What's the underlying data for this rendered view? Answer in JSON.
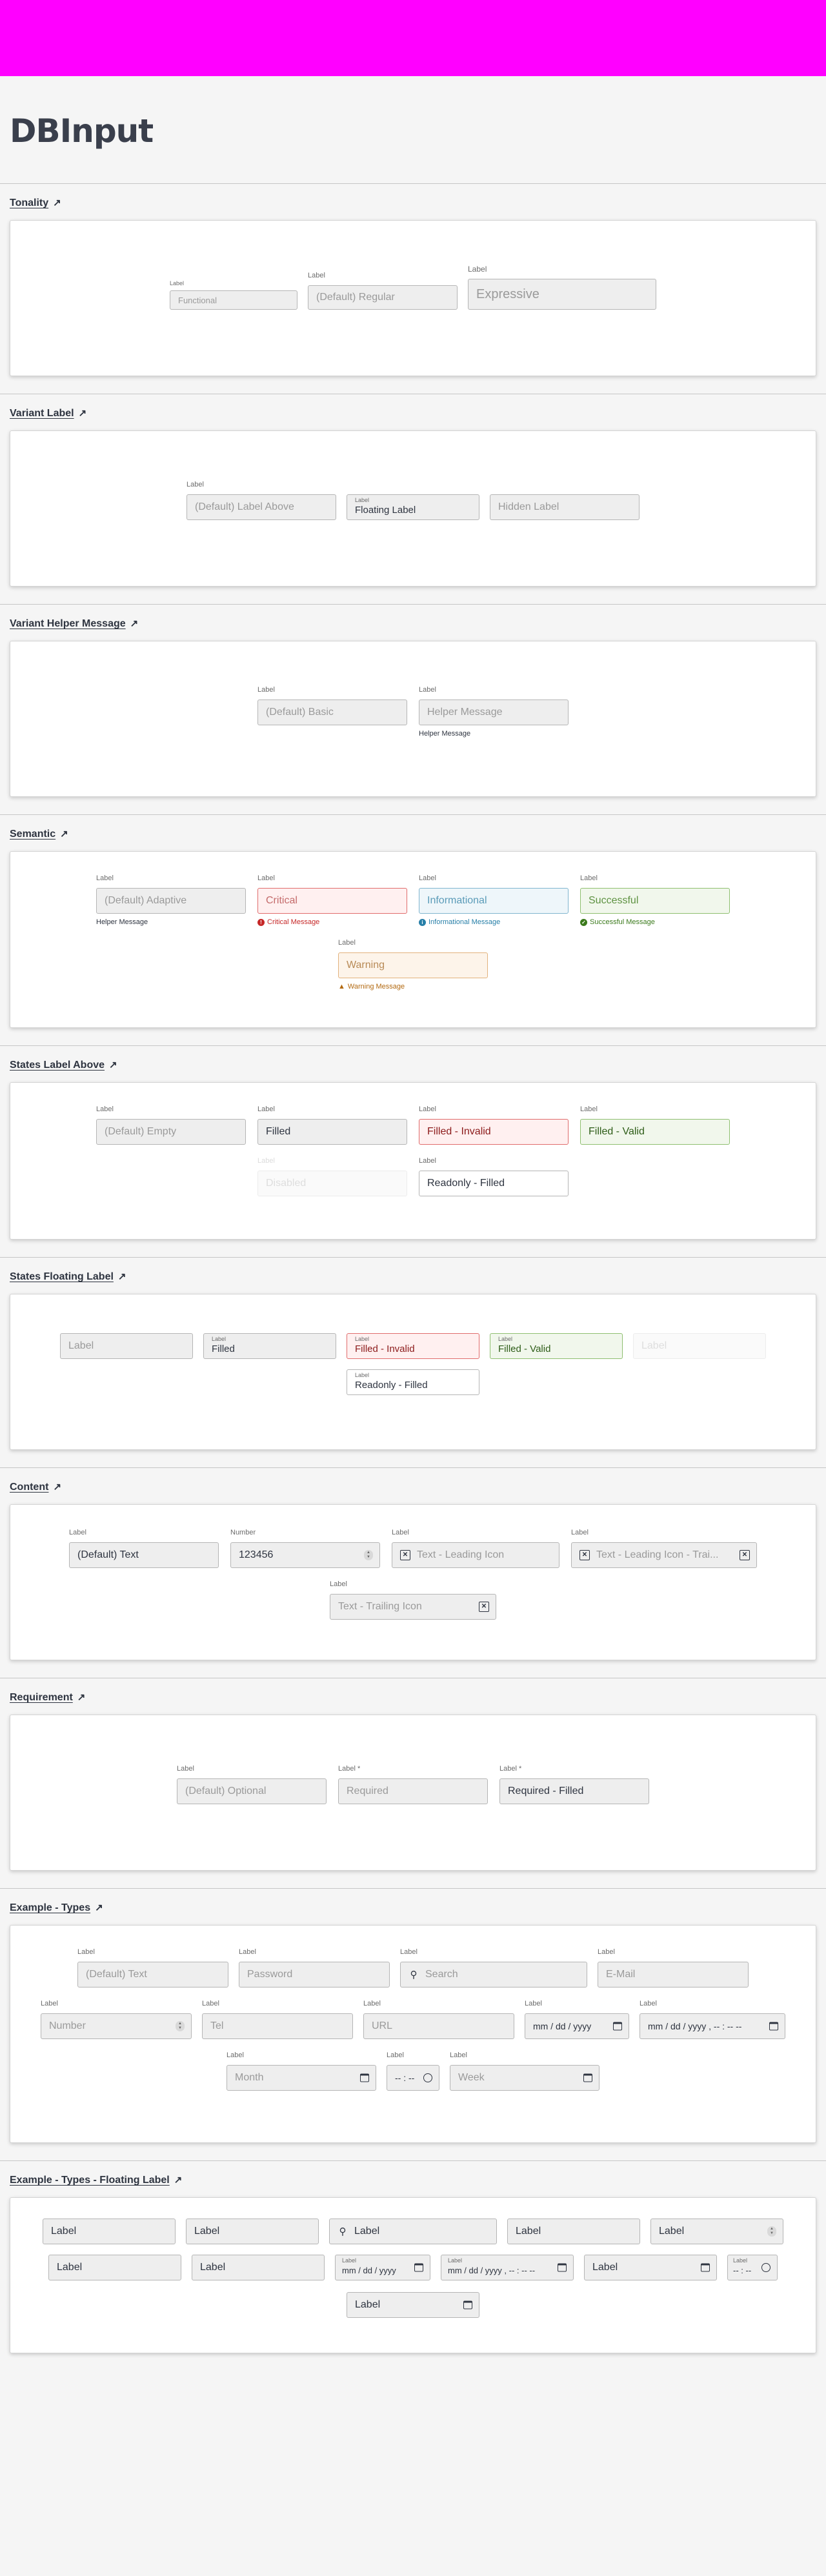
{
  "page": {
    "title": "DBInput",
    "accent": "#ff00ff"
  },
  "icons": {
    "section_link": "arrow-up-right-icon",
    "clear": "clear-x-icon",
    "search": "search-icon",
    "calendar": "calendar-icon",
    "clock": "clock-icon",
    "stepper": "number-stepper-icon"
  },
  "sections": {
    "tonality": {
      "title": "Tonality",
      "fields": [
        {
          "label": "Label",
          "placeholder": "Functional"
        },
        {
          "label": "Label",
          "placeholder": "(Default) Regular"
        },
        {
          "label": "Label",
          "placeholder": "Expressive"
        }
      ]
    },
    "variant_label": {
      "title": "Variant Label",
      "fields": [
        {
          "label": "Label",
          "placeholder": "(Default) Label Above"
        },
        {
          "label": "Label",
          "value": "Floating Label"
        },
        {
          "placeholder": "Hidden Label"
        }
      ]
    },
    "variant_helper": {
      "title": "Variant Helper Message",
      "fields": [
        {
          "label": "Label",
          "placeholder": "(Default) Basic"
        },
        {
          "label": "Label",
          "placeholder": "Helper Message",
          "helper": "Helper Message"
        }
      ]
    },
    "semantic": {
      "title": "Semantic",
      "fields": [
        {
          "label": "Label",
          "placeholder": "(Default) Adaptive",
          "helper": "Helper Message"
        },
        {
          "label": "Label",
          "placeholder": "Critical",
          "helper": "Critical Message"
        },
        {
          "label": "Label",
          "placeholder": "Informational",
          "helper": "Informational Message"
        },
        {
          "label": "Label",
          "placeholder": "Successful",
          "helper": "Successful Message"
        },
        {
          "label": "Label",
          "placeholder": "Warning",
          "helper": "Warning Message"
        }
      ]
    },
    "states_above": {
      "title": "States Label Above",
      "fields": [
        {
          "label": "Label",
          "placeholder": "(Default) Empty"
        },
        {
          "label": "Label",
          "value": "Filled"
        },
        {
          "label": "Label",
          "value": "Filled - Invalid"
        },
        {
          "label": "Label",
          "value": "Filled - Valid"
        },
        {
          "label": "Label",
          "placeholder": "Disabled"
        },
        {
          "label": "Label",
          "value": "Readonly - Filled"
        }
      ]
    },
    "states_floating": {
      "title": "States Floating Label",
      "fields": [
        {
          "placeholder": "Label"
        },
        {
          "label": "Label",
          "value": "Filled"
        },
        {
          "label": "Label",
          "value": "Filled - Invalid"
        },
        {
          "label": "Label",
          "value": "Filled - Valid"
        },
        {
          "placeholder": "Label"
        },
        {
          "label": "Label",
          "value": "Readonly - Filled"
        }
      ]
    },
    "content": {
      "title": "Content",
      "fields": [
        {
          "label": "Label",
          "value": "(Default) Text"
        },
        {
          "label": "Number",
          "value": "123456"
        },
        {
          "label": "Label",
          "placeholder": "Text - Leading Icon"
        },
        {
          "label": "Label",
          "placeholder": "Text - Leading Icon - Trai..."
        },
        {
          "label": "Label",
          "placeholder": "Text - Trailing Icon"
        }
      ]
    },
    "requirement": {
      "title": "Requirement",
      "fields": [
        {
          "label": "Label",
          "placeholder": "(Default) Optional"
        },
        {
          "label": "Label *",
          "placeholder": "Required"
        },
        {
          "label": "Label *",
          "value": "Required - Filled"
        }
      ]
    },
    "types": {
      "title": "Example - Types",
      "fields": [
        {
          "label": "Label",
          "placeholder": "(Default) Text"
        },
        {
          "label": "Label",
          "placeholder": "Password"
        },
        {
          "label": "Label",
          "placeholder": "Search"
        },
        {
          "label": "Label",
          "placeholder": "E-Mail"
        },
        {
          "label": "Label",
          "placeholder": "Number"
        },
        {
          "label": "Label",
          "placeholder": "Tel"
        },
        {
          "label": "Label",
          "placeholder": "URL"
        },
        {
          "label": "Label",
          "value": "mm / dd / yyyy"
        },
        {
          "label": "Label",
          "value": "mm / dd / yyyy ,  -- : --  --"
        },
        {
          "label": "Label",
          "placeholder": "Month"
        },
        {
          "label": "Label",
          "value": "-- : --"
        },
        {
          "label": "Label",
          "placeholder": "Week"
        }
      ]
    },
    "types_floating": {
      "title": "Example - Types - Floating Label",
      "fields": [
        {
          "placeholder": "Label"
        },
        {
          "placeholder": "Label"
        },
        {
          "placeholder": "Label"
        },
        {
          "placeholder": "Label"
        },
        {
          "placeholder": "Label"
        },
        {
          "placeholder": "Label"
        },
        {
          "placeholder": "Label"
        },
        {
          "label": "Label",
          "value": "mm / dd / yyyy"
        },
        {
          "label": "Label",
          "value": "mm / dd / yyyy ,  -- : --  --"
        },
        {
          "placeholder": "Label"
        },
        {
          "label": "Label",
          "value": "-- : --"
        },
        {
          "placeholder": "Label"
        }
      ]
    }
  }
}
